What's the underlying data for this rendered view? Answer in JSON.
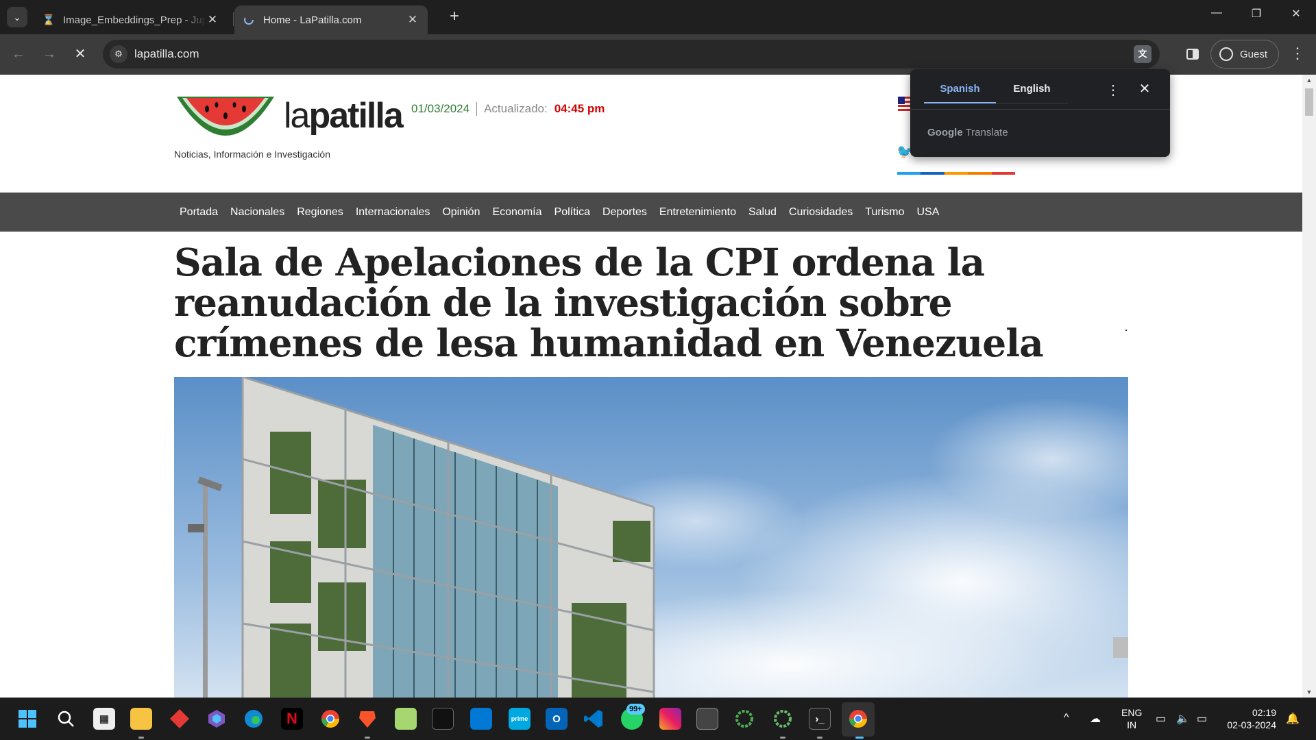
{
  "browser": {
    "tabs": [
      {
        "title": "Image_Embeddings_Prep - Jupyter",
        "favicon": "hourglass-icon"
      },
      {
        "title": "Home - LaPatilla.com",
        "favicon": "loading-icon"
      }
    ],
    "url": "lapatilla.com",
    "profile_label": "Guest"
  },
  "site": {
    "logo_word_light": "la",
    "logo_word_bold": "patilla",
    "tagline": "Noticias, Información e Investigación",
    "date": "01/03/2024",
    "updated_label": "Actualizado:",
    "updated_time": "04:45 pm",
    "nav": [
      "Portada",
      "Nacionales",
      "Regiones",
      "Internacionales",
      "Opinión",
      "Economía",
      "Política",
      "Deportes",
      "Entretenimiento",
      "Salud",
      "Curiosidades",
      "Turismo",
      "USA"
    ],
    "headline": "Sala de Apelaciones de la CPI ordena la reanudación de la investigación sobre crímenes de lesa humanidad en Venezuela",
    "social_colors": [
      "#1da1f2",
      "#1565c0",
      "#ff9800",
      "#f57c00",
      "#e53935"
    ]
  },
  "translate_popup": {
    "source_lang": "Spanish",
    "target_lang": "English",
    "brand_google": "Google",
    "brand_translate": "Translate"
  },
  "taskbar": {
    "whatsapp_badge": "99+",
    "lang_top": "ENG",
    "lang_bottom": "IN",
    "time": "02:19",
    "date": "02-03-2024"
  }
}
